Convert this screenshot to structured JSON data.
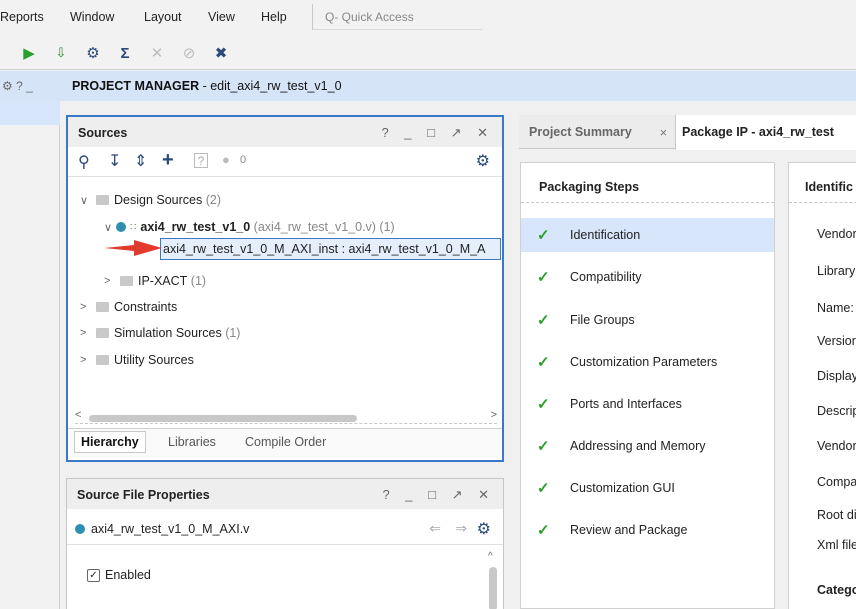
{
  "menu": {
    "items": [
      {
        "label": "Reports",
        "underline": "R",
        "rest": "eports"
      },
      {
        "label": "Window",
        "underline": "W",
        "rest": "indow"
      },
      {
        "label": "Layout",
        "underline": "",
        "pre": "La",
        "under2": "y",
        "post": "out"
      },
      {
        "label": "View",
        "underline": "V",
        "rest": "iew"
      },
      {
        "label": "Help",
        "underline": "H",
        "rest": "elp"
      }
    ],
    "quick_access": "Q- Quick Access"
  },
  "left_strip": {
    "header": "⚙ ? _"
  },
  "project_manager": {
    "title": "PROJECT MANAGER",
    "subtitle": " - edit_axi4_rw_test_v1_0"
  },
  "sources": {
    "title": "Sources",
    "controls": "? _ □ ↗ ✕",
    "error_count": "0",
    "tree": {
      "design_sources": "Design Sources",
      "design_sources_count": "(2)",
      "top_module": "axi4_rw_test_v1_0",
      "top_module_file": "(axi4_rw_test_v1_0.v) (1)",
      "instance": "axi4_rw_test_v1_0_M_AXI_inst : axi4_rw_test_v1_0_M_A",
      "ipxact": "IP-XACT",
      "ipxact_count": "(1)",
      "constraints": "Constraints",
      "simulation_sources": "Simulation Sources",
      "simulation_count": "(1)",
      "utility_sources": "Utility Sources"
    },
    "tabs": [
      "Hierarchy",
      "Libraries",
      "Compile Order"
    ]
  },
  "source_file_properties": {
    "title": "Source File Properties",
    "controls": "? _ □ ↗ ✕",
    "file": "axi4_rw_test_v1_0_M_AXI.v",
    "enabled_label": "Enabled"
  },
  "right_tabs": {
    "tab1": "Project Summary",
    "tab1_close": "×",
    "tab2": "Package IP - axi4_rw_test"
  },
  "packaging_steps": {
    "title": "Packaging Steps",
    "steps": [
      "Identification",
      "Compatibility",
      "File Groups",
      "Customization Parameters",
      "Ports and Interfaces",
      "Addressing and Memory",
      "Customization GUI",
      "Review and Package"
    ]
  },
  "identification": {
    "title": "Identific",
    "rows": [
      "Vendor",
      "Library:",
      "Name:",
      "Versior",
      "Display",
      "Descrip",
      "Vendor",
      "Compa",
      "Root di",
      "Xml file"
    ],
    "footer": "Catego"
  },
  "colors": {
    "accent": "#3b78c8",
    "check": "#2aa02a",
    "selected": "#d7e6fb",
    "header": "#d6e4f8"
  }
}
